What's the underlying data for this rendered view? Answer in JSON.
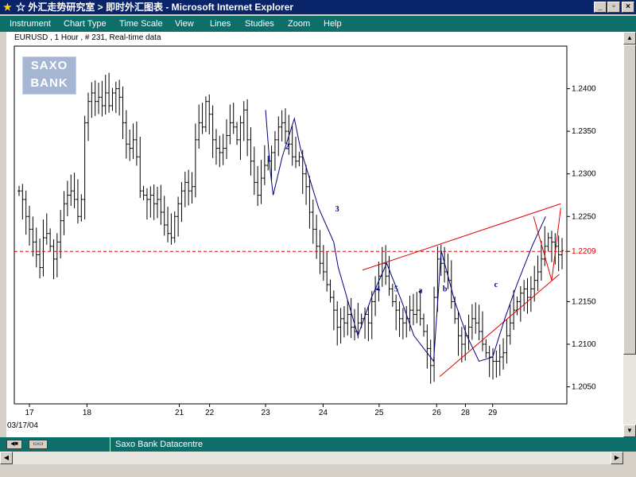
{
  "window": {
    "title": "☆ 外汇走势研究室 > 即时外汇图表 - Microsoft Internet Explorer",
    "buttons": {
      "minimize": "_",
      "maximize": "▫",
      "close": "×"
    }
  },
  "menu": [
    "Instrument",
    "Chart Type",
    "Time Scale",
    "View",
    "Lines",
    "Studies",
    "Zoom",
    "Help"
  ],
  "chart_header": "EURUSD , 1 Hour , # 231, Real-time data",
  "logo": {
    "line1": "SAXO",
    "line2": "BANK"
  },
  "status": {
    "text": "Saxo Bank Datacentre"
  },
  "start_date": "03/17/04",
  "colors": {
    "titlebar": "#0a246a",
    "menubar": "#0e6f6a",
    "trendline": "#e00000",
    "wave": "#00007f",
    "candle": "#000000"
  },
  "chart_data": {
    "type": "candlestick",
    "ylim": [
      1.203,
      1.245
    ],
    "yticks": [
      "1.2400",
      "1.2350",
      "1.2300",
      "1.2250",
      "1.2209",
      "1.2150",
      "1.2100",
      "1.2050"
    ],
    "ytick_values": [
      1.24,
      1.235,
      1.23,
      1.225,
      1.2209,
      1.215,
      1.21,
      1.205
    ],
    "xticks": [
      {
        "label": "17",
        "x": 0.9
      },
      {
        "label": "18",
        "x": 4.7
      },
      {
        "label": "21",
        "x": 10.8
      },
      {
        "label": "22",
        "x": 12.8
      },
      {
        "label": "23",
        "x": 16.5
      },
      {
        "label": "24",
        "x": 20.3
      },
      {
        "label": "25",
        "x": 24.0
      },
      {
        "label": "26",
        "x": 27.8
      },
      {
        "label": "28",
        "x": 29.7
      },
      {
        "label": "29",
        "x": 31.5
      }
    ],
    "current_level": {
      "value": 1.2209,
      "label": "1.2209"
    },
    "close": [
      1.228,
      1.227,
      1.225,
      1.2235,
      1.222,
      1.2205,
      1.219,
      1.2225,
      1.223,
      1.2215,
      1.22,
      1.222,
      1.2245,
      1.2265,
      1.2275,
      1.228,
      1.227,
      1.225,
      1.227,
      1.236,
      1.2385,
      1.2395,
      1.2385,
      1.239,
      1.238,
      1.2395,
      1.238,
      1.2395,
      1.24,
      1.239,
      1.236,
      1.2335,
      1.233,
      1.234,
      1.232,
      1.228,
      1.2275,
      1.227,
      1.2275,
      1.2265,
      1.227,
      1.2255,
      1.224,
      1.223,
      1.2225,
      1.225,
      1.2265,
      1.228,
      1.229,
      1.228,
      1.2285,
      1.234,
      1.236,
      1.2355,
      1.2385,
      1.237,
      1.234,
      1.233,
      1.2325,
      1.233,
      1.2345,
      1.236,
      1.2355,
      1.234,
      1.236,
      1.2375,
      1.234,
      1.2315,
      1.229,
      1.2275,
      1.2295,
      1.231,
      1.2315,
      1.2325,
      1.234,
      1.2355,
      1.236,
      1.235,
      1.2335,
      1.232,
      1.2315,
      1.232,
      1.23,
      1.2285,
      1.2255,
      1.2235,
      1.2215,
      1.2195,
      1.2185,
      1.217,
      1.2155,
      1.214,
      1.212,
      1.213,
      1.2125,
      1.2135,
      1.212,
      1.2115,
      1.2125,
      1.213,
      1.2135,
      1.2125,
      1.215,
      1.2165,
      1.218,
      1.2195,
      1.218,
      1.2165,
      1.215,
      1.214,
      1.213,
      1.2125,
      1.213,
      1.214,
      1.2135,
      1.214,
      1.213,
      1.2115,
      1.2095,
      1.2075,
      1.2155,
      1.22,
      1.2195,
      1.2185,
      1.2175,
      1.215,
      1.213,
      1.211,
      1.21,
      1.211,
      1.212,
      1.213,
      1.2125,
      1.2115,
      1.21,
      1.209,
      1.2085,
      1.208,
      1.208,
      1.2085,
      1.209,
      1.211,
      1.2125,
      1.214,
      1.215,
      1.216,
      1.2165,
      1.2155,
      1.2165,
      1.2175,
      1.2185,
      1.22,
      1.2215,
      1.2225,
      1.222,
      1.2215,
      1.2205,
      1.221
    ],
    "wave_path": [
      [
        16.5,
        1.2375
      ],
      [
        16.8,
        1.2305
      ],
      [
        17.0,
        1.2275
      ],
      [
        17.6,
        1.232
      ],
      [
        18.4,
        1.2365
      ],
      [
        18.8,
        1.233
      ],
      [
        19.4,
        1.2295
      ],
      [
        20.0,
        1.226
      ],
      [
        21.0,
        1.222
      ],
      [
        21.3,
        1.219
      ],
      [
        22.6,
        1.211
      ],
      [
        23.5,
        1.2155
      ],
      [
        24.5,
        1.2195
      ],
      [
        25.5,
        1.215
      ],
      [
        26.3,
        1.211
      ],
      [
        27.6,
        1.208
      ],
      [
        28.1,
        1.221
      ],
      [
        29.0,
        1.215
      ],
      [
        29.8,
        1.211
      ],
      [
        30.6,
        1.208
      ],
      [
        31.5,
        1.2085
      ],
      [
        32.3,
        1.213
      ],
      [
        33.1,
        1.217
      ],
      [
        34.1,
        1.2215
      ],
      [
        35.0,
        1.225
      ]
    ],
    "wave_labels": [
      {
        "text": "1",
        "x": 16.6,
        "y": 1.2315
      },
      {
        "text": "2",
        "x": 17.8,
        "y": 1.2329
      },
      {
        "text": "3",
        "x": 21.1,
        "y": 1.2256
      },
      {
        "text": "4",
        "x": 23.8,
        "y": 1.2162
      },
      {
        "text": "5",
        "x": 25.0,
        "y": 1.2162
      },
      {
        "text": "a",
        "x": 26.6,
        "y": 1.216
      },
      {
        "text": "b",
        "x": 28.2,
        "y": 1.2162
      },
      {
        "text": "c",
        "x": 31.6,
        "y": 1.2167
      }
    ],
    "trendlines": [
      {
        "x1": 22.9,
        "y1": 1.2187,
        "x2": 36.0,
        "y2": 1.2265
      },
      {
        "x1": 28.0,
        "y1": 1.2062,
        "x2": 35.9,
        "y2": 1.2182
      },
      {
        "x1": 34.2,
        "y1": 1.225,
        "x2": 35.4,
        "y2": 1.2175
      },
      {
        "x1": 35.4,
        "y1": 1.2175,
        "x2": 36.0,
        "y2": 1.226
      }
    ]
  }
}
